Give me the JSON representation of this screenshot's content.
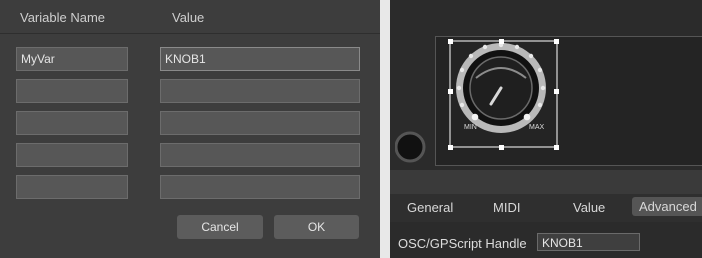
{
  "dialog": {
    "col_var": "Variable Name",
    "col_val": "Value",
    "rows": [
      {
        "name": "MyVar",
        "value": "KNOB1"
      },
      {
        "name": "",
        "value": ""
      },
      {
        "name": "",
        "value": ""
      },
      {
        "name": "",
        "value": ""
      },
      {
        "name": "",
        "value": ""
      }
    ],
    "cancel": "Cancel",
    "ok": "OK"
  },
  "editor": {
    "knob": {
      "min_label": "MIN",
      "max_label": "MAX",
      "icon": "rotary-knob"
    },
    "tabs": [
      {
        "label": "General",
        "active": false
      },
      {
        "label": "MIDI",
        "active": false
      },
      {
        "label": "Value",
        "active": false
      },
      {
        "label": "Advanced",
        "active": true
      }
    ],
    "handle_label": "OSC/GPScript Handle",
    "handle_value": "KNOB1"
  }
}
